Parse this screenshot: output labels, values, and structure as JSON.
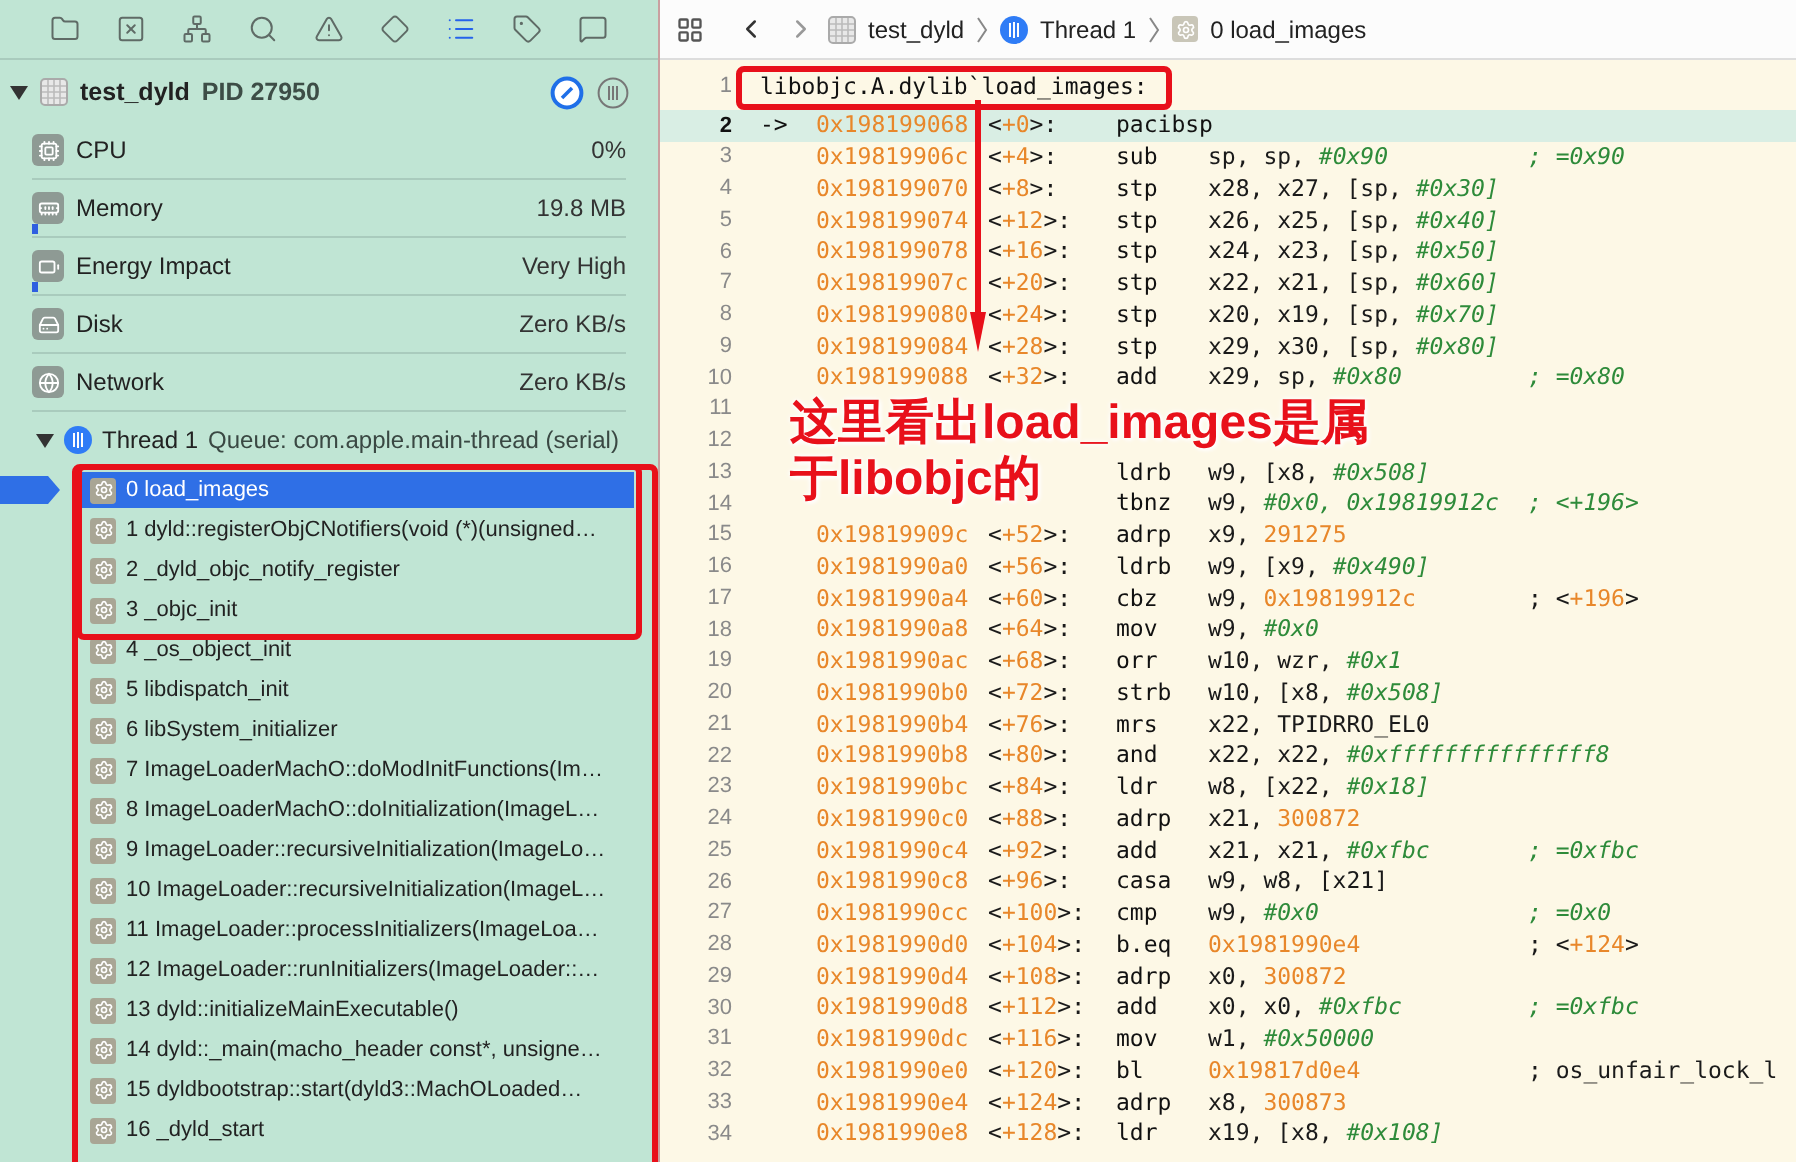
{
  "sidebar": {
    "toolbar": [
      {
        "kind": "folder",
        "selected": false
      },
      {
        "kind": "xbox",
        "selected": false
      },
      {
        "kind": "hierarchy",
        "selected": false
      },
      {
        "kind": "search",
        "selected": false
      },
      {
        "kind": "warning",
        "selected": false
      },
      {
        "kind": "diamond",
        "selected": false
      },
      {
        "kind": "list",
        "selected": true
      },
      {
        "kind": "tag",
        "selected": false
      },
      {
        "kind": "message",
        "selected": false
      }
    ],
    "process": {
      "name": "test_dyld",
      "pid": "PID 27950",
      "expanded": true
    },
    "gauges": [
      {
        "kind": "cpu",
        "label": "CPU",
        "value": "0%"
      },
      {
        "kind": "memory",
        "label": "Memory",
        "value": "19.8 MB",
        "level": 0.01
      },
      {
        "kind": "energy",
        "label": "Energy Impact",
        "value": "Very High",
        "level": 0.01
      },
      {
        "kind": "disk",
        "label": "Disk",
        "value": "Zero KB/s"
      },
      {
        "kind": "network",
        "label": "Network",
        "value": "Zero KB/s"
      }
    ],
    "thread": {
      "label": "Thread 1",
      "queue": "Queue: com.apple.main-thread (serial)",
      "expanded": true
    },
    "frames": [
      {
        "label": "0 load_images",
        "selected": true
      },
      {
        "label": "1 dyld::registerObjCNotifiers(void (*)(unsigned…",
        "selected": false
      },
      {
        "label": "2 _dyld_objc_notify_register",
        "selected": false
      },
      {
        "label": "3 _objc_init",
        "selected": false
      },
      {
        "label": "4 _os_object_init",
        "selected": false
      },
      {
        "label": "5 libdispatch_init",
        "selected": false
      },
      {
        "label": "6 libSystem_initializer",
        "selected": false
      },
      {
        "label": "7 ImageLoaderMachO::doModInitFunctions(Im…",
        "selected": false
      },
      {
        "label": "8 ImageLoaderMachO::doInitialization(ImageL…",
        "selected": false
      },
      {
        "label": "9 ImageLoader::recursiveInitialization(ImageLo…",
        "selected": false
      },
      {
        "label": "10 ImageLoader::recursiveInitialization(ImageL…",
        "selected": false
      },
      {
        "label": "11 ImageLoader::processInitializers(ImageLoa…",
        "selected": false
      },
      {
        "label": "12 ImageLoader::runInitializers(ImageLoader::…",
        "selected": false
      },
      {
        "label": "13 dyld::initializeMainExecutable()",
        "selected": false
      },
      {
        "label": "14 dyld::_main(macho_header const*, unsigne…",
        "selected": false
      },
      {
        "label": "15 dyldbootstrap::start(dyld3::MachOLoaded…",
        "selected": false
      },
      {
        "label": "16 _dyld_start",
        "selected": false
      }
    ]
  },
  "jump_bar": [
    {
      "kind": "process",
      "label": "test_dyld"
    },
    {
      "kind": "thread",
      "label": "Thread 1"
    },
    {
      "kind": "frame",
      "label": "0 load_images"
    }
  ],
  "code": {
    "header": {
      "n": "1",
      "text": "libobjc.A.dylib`load_images:"
    },
    "rows": [
      {
        "n": "2",
        "marker": "->",
        "addr": "0x198199068",
        "off": [
          {
            "text": "<",
            "kind": "plain"
          },
          {
            "text": "+0",
            "kind": "number"
          },
          {
            "text": ">:",
            "kind": "plain"
          }
        ],
        "op": "pacibsp"
      },
      {
        "n": "3",
        "addr": "0x19819906c",
        "off": [
          {
            "text": "<",
            "kind": "plain"
          },
          {
            "text": "+4",
            "kind": "number"
          },
          {
            "text": ">:",
            "kind": "plain"
          }
        ],
        "op": "sub",
        "args": [
          {
            "text": "sp, sp, ",
            "kind": "plain"
          },
          {
            "text": "#0x90",
            "kind": "immediate"
          }
        ],
        "cmt": [
          {
            "text": "; =0x90",
            "kind": "immediate"
          }
        ]
      },
      {
        "n": "4",
        "addr": "0x198199070",
        "off": [
          {
            "text": "<",
            "kind": "plain"
          },
          {
            "text": "+8",
            "kind": "number"
          },
          {
            "text": ">:",
            "kind": "plain"
          }
        ],
        "op": "stp",
        "args": [
          {
            "text": "x28, x27, [sp, ",
            "kind": "plain"
          },
          {
            "text": "#0x30]",
            "kind": "immediate"
          }
        ]
      },
      {
        "n": "5",
        "addr": "0x198199074",
        "off": [
          {
            "text": "<",
            "kind": "plain"
          },
          {
            "text": "+12",
            "kind": "number"
          },
          {
            "text": ">:",
            "kind": "plain"
          }
        ],
        "op": "stp",
        "args": [
          {
            "text": "x26, x25, [sp, ",
            "kind": "plain"
          },
          {
            "text": "#0x40]",
            "kind": "immediate"
          }
        ]
      },
      {
        "n": "6",
        "addr": "0x198199078",
        "off": [
          {
            "text": "<",
            "kind": "plain"
          },
          {
            "text": "+16",
            "kind": "number"
          },
          {
            "text": ">:",
            "kind": "plain"
          }
        ],
        "op": "stp",
        "args": [
          {
            "text": "x24, x23, [sp, ",
            "kind": "plain"
          },
          {
            "text": "#0x50]",
            "kind": "immediate"
          }
        ]
      },
      {
        "n": "7",
        "addr": "0x19819907c",
        "off": [
          {
            "text": "<",
            "kind": "plain"
          },
          {
            "text": "+20",
            "kind": "number"
          },
          {
            "text": ">:",
            "kind": "plain"
          }
        ],
        "op": "stp",
        "args": [
          {
            "text": "x22, x21, [sp, ",
            "kind": "plain"
          },
          {
            "text": "#0x60]",
            "kind": "immediate"
          }
        ]
      },
      {
        "n": "8",
        "addr": "0x198199080",
        "off": [
          {
            "text": "<",
            "kind": "plain"
          },
          {
            "text": "+24",
            "kind": "number"
          },
          {
            "text": ">:",
            "kind": "plain"
          }
        ],
        "op": "stp",
        "args": [
          {
            "text": "x20, x19, [sp, ",
            "kind": "plain"
          },
          {
            "text": "#0x70]",
            "kind": "immediate"
          }
        ]
      },
      {
        "n": "9",
        "addr": "0x198199084",
        "off": [
          {
            "text": "<",
            "kind": "plain"
          },
          {
            "text": "+28",
            "kind": "number"
          },
          {
            "text": ">:",
            "kind": "plain"
          }
        ],
        "op": "stp",
        "args": [
          {
            "text": "x29, x30, [sp, ",
            "kind": "plain"
          },
          {
            "text": "#0x80]",
            "kind": "immediate"
          }
        ]
      },
      {
        "n": "10",
        "addr": "0x198199088",
        "off": [
          {
            "text": "<",
            "kind": "plain"
          },
          {
            "text": "+32",
            "kind": "number"
          },
          {
            "text": ">:",
            "kind": "plain"
          }
        ],
        "op": "add",
        "args": [
          {
            "text": "x29, sp, ",
            "kind": "plain"
          },
          {
            "text": "#0x80",
            "kind": "immediate"
          }
        ],
        "cmt": [
          {
            "text": "; =0x80",
            "kind": "immediate"
          }
        ]
      },
      {
        "n": "11"
      },
      {
        "n": "12"
      },
      {
        "n": "13",
        "op": "ldrb",
        "args": [
          {
            "text": "w9, [x8, ",
            "kind": "plain"
          },
          {
            "text": "#0x508]",
            "kind": "immediate"
          }
        ]
      },
      {
        "n": "14",
        "op": "tbnz",
        "args": [
          {
            "text": "w9, ",
            "kind": "plain"
          },
          {
            "text": "#0x0, 0x19819912c",
            "kind": "immediate"
          }
        ],
        "cmt": [
          {
            "text": "; <+196>",
            "kind": "immediate"
          }
        ]
      },
      {
        "n": "15",
        "addr": "0x19819909c",
        "off": [
          {
            "text": "<",
            "kind": "plain"
          },
          {
            "text": "+52",
            "kind": "number"
          },
          {
            "text": ">:",
            "kind": "plain"
          }
        ],
        "op": "adrp",
        "args": [
          {
            "text": "x9, ",
            "kind": "plain"
          },
          {
            "text": "291275",
            "kind": "number"
          }
        ]
      },
      {
        "n": "16",
        "addr": "0x1981990a0",
        "off": [
          {
            "text": "<",
            "kind": "plain"
          },
          {
            "text": "+56",
            "kind": "number"
          },
          {
            "text": ">:",
            "kind": "plain"
          }
        ],
        "op": "ldrb",
        "args": [
          {
            "text": "w9, [x9, ",
            "kind": "plain"
          },
          {
            "text": "#0x490]",
            "kind": "immediate"
          }
        ]
      },
      {
        "n": "17",
        "addr": "0x1981990a4",
        "off": [
          {
            "text": "<",
            "kind": "plain"
          },
          {
            "text": "+60",
            "kind": "number"
          },
          {
            "text": ">:",
            "kind": "plain"
          }
        ],
        "op": "cbz",
        "args": [
          {
            "text": "w9, ",
            "kind": "plain"
          },
          {
            "text": "0x19819912c",
            "kind": "number"
          }
        ],
        "cmt": [
          {
            "text": "; <",
            "kind": "plain"
          },
          {
            "text": "+196",
            "kind": "number"
          },
          {
            "text": ">",
            "kind": "plain"
          }
        ]
      },
      {
        "n": "18",
        "addr": "0x1981990a8",
        "off": [
          {
            "text": "<",
            "kind": "plain"
          },
          {
            "text": "+64",
            "kind": "number"
          },
          {
            "text": ">:",
            "kind": "plain"
          }
        ],
        "op": "mov",
        "args": [
          {
            "text": "w9, ",
            "kind": "plain"
          },
          {
            "text": "#0x0",
            "kind": "immediate"
          }
        ]
      },
      {
        "n": "19",
        "addr": "0x1981990ac",
        "off": [
          {
            "text": "<",
            "kind": "plain"
          },
          {
            "text": "+68",
            "kind": "number"
          },
          {
            "text": ">:",
            "kind": "plain"
          }
        ],
        "op": "orr",
        "args": [
          {
            "text": "w10, wzr, ",
            "kind": "plain"
          },
          {
            "text": "#0x1",
            "kind": "immediate"
          }
        ]
      },
      {
        "n": "20",
        "addr": "0x1981990b0",
        "off": [
          {
            "text": "<",
            "kind": "plain"
          },
          {
            "text": "+72",
            "kind": "number"
          },
          {
            "text": ">:",
            "kind": "plain"
          }
        ],
        "op": "strb",
        "args": [
          {
            "text": "w10, [x8, ",
            "kind": "plain"
          },
          {
            "text": "#0x508]",
            "kind": "immediate"
          }
        ]
      },
      {
        "n": "21",
        "addr": "0x1981990b4",
        "off": [
          {
            "text": "<",
            "kind": "plain"
          },
          {
            "text": "+76",
            "kind": "number"
          },
          {
            "text": ">:",
            "kind": "plain"
          }
        ],
        "op": "mrs",
        "args": [
          {
            "text": "x22, TPIDRRO_EL0",
            "kind": "plain"
          }
        ]
      },
      {
        "n": "22",
        "addr": "0x1981990b8",
        "off": [
          {
            "text": "<",
            "kind": "plain"
          },
          {
            "text": "+80",
            "kind": "number"
          },
          {
            "text": ">:",
            "kind": "plain"
          }
        ],
        "op": "and",
        "args": [
          {
            "text": "x22, x22, ",
            "kind": "plain"
          },
          {
            "text": "#0xfffffffffffffff8",
            "kind": "immediate"
          }
        ]
      },
      {
        "n": "23",
        "addr": "0x1981990bc",
        "off": [
          {
            "text": "<",
            "kind": "plain"
          },
          {
            "text": "+84",
            "kind": "number"
          },
          {
            "text": ">:",
            "kind": "plain"
          }
        ],
        "op": "ldr",
        "args": [
          {
            "text": "w8, [x22, ",
            "kind": "plain"
          },
          {
            "text": "#0x18]",
            "kind": "immediate"
          }
        ]
      },
      {
        "n": "24",
        "addr": "0x1981990c0",
        "off": [
          {
            "text": "<",
            "kind": "plain"
          },
          {
            "text": "+88",
            "kind": "number"
          },
          {
            "text": ">:",
            "kind": "plain"
          }
        ],
        "op": "adrp",
        "args": [
          {
            "text": "x21, ",
            "kind": "plain"
          },
          {
            "text": "300872",
            "kind": "number"
          }
        ]
      },
      {
        "n": "25",
        "addr": "0x1981990c4",
        "off": [
          {
            "text": "<",
            "kind": "plain"
          },
          {
            "text": "+92",
            "kind": "number"
          },
          {
            "text": ">:",
            "kind": "plain"
          }
        ],
        "op": "add",
        "args": [
          {
            "text": "x21, x21, ",
            "kind": "plain"
          },
          {
            "text": "#0xfbc",
            "kind": "immediate"
          }
        ],
        "cmt": [
          {
            "text": "; =0xfbc",
            "kind": "immediate"
          }
        ]
      },
      {
        "n": "26",
        "addr": "0x1981990c8",
        "off": [
          {
            "text": "<",
            "kind": "plain"
          },
          {
            "text": "+96",
            "kind": "number"
          },
          {
            "text": ">:",
            "kind": "plain"
          }
        ],
        "op": "casa",
        "args": [
          {
            "text": "w9, w8, [x21]",
            "kind": "plain"
          }
        ]
      },
      {
        "n": "27",
        "addr": "0x1981990cc",
        "off": [
          {
            "text": "<",
            "kind": "plain"
          },
          {
            "text": "+100",
            "kind": "number"
          },
          {
            "text": ">:",
            "kind": "plain"
          }
        ],
        "op": "cmp",
        "args": [
          {
            "text": "w9, ",
            "kind": "plain"
          },
          {
            "text": "#0x0",
            "kind": "immediate"
          }
        ],
        "cmt": [
          {
            "text": "; =0x0",
            "kind": "immediate"
          }
        ]
      },
      {
        "n": "28",
        "addr": "0x1981990d0",
        "off": [
          {
            "text": "<",
            "kind": "plain"
          },
          {
            "text": "+104",
            "kind": "number"
          },
          {
            "text": ">:",
            "kind": "plain"
          }
        ],
        "op": "b.eq",
        "args": [
          {
            "text": "0x1981990e4",
            "kind": "number"
          }
        ],
        "cmt": [
          {
            "text": "; <",
            "kind": "plain"
          },
          {
            "text": "+124",
            "kind": "number"
          },
          {
            "text": ">",
            "kind": "plain"
          }
        ]
      },
      {
        "n": "29",
        "addr": "0x1981990d4",
        "off": [
          {
            "text": "<",
            "kind": "plain"
          },
          {
            "text": "+108",
            "kind": "number"
          },
          {
            "text": ">:",
            "kind": "plain"
          }
        ],
        "op": "adrp",
        "args": [
          {
            "text": "x0, ",
            "kind": "plain"
          },
          {
            "text": "300872",
            "kind": "number"
          }
        ]
      },
      {
        "n": "30",
        "addr": "0x1981990d8",
        "off": [
          {
            "text": "<",
            "kind": "plain"
          },
          {
            "text": "+112",
            "kind": "number"
          },
          {
            "text": ">:",
            "kind": "plain"
          }
        ],
        "op": "add",
        "args": [
          {
            "text": "x0, x0, ",
            "kind": "plain"
          },
          {
            "text": "#0xfbc",
            "kind": "immediate"
          }
        ],
        "cmt": [
          {
            "text": "; =0xfbc",
            "kind": "immediate"
          }
        ]
      },
      {
        "n": "31",
        "addr": "0x1981990dc",
        "off": [
          {
            "text": "<",
            "kind": "plain"
          },
          {
            "text": "+116",
            "kind": "number"
          },
          {
            "text": ">:",
            "kind": "plain"
          }
        ],
        "op": "mov",
        "args": [
          {
            "text": "w1, ",
            "kind": "plain"
          },
          {
            "text": "#0x50000",
            "kind": "immediate"
          }
        ]
      },
      {
        "n": "32",
        "addr": "0x1981990e0",
        "off": [
          {
            "text": "<",
            "kind": "plain"
          },
          {
            "text": "+120",
            "kind": "number"
          },
          {
            "text": ">:",
            "kind": "plain"
          }
        ],
        "op": "bl",
        "args": [
          {
            "text": "0x19817d0e4",
            "kind": "number"
          }
        ],
        "cmt": [
          {
            "text": "; os_unfair_lock_l",
            "kind": "plain"
          }
        ]
      },
      {
        "n": "33",
        "addr": "0x1981990e4",
        "off": [
          {
            "text": "<",
            "kind": "plain"
          },
          {
            "text": "+124",
            "kind": "number"
          },
          {
            "text": ">:",
            "kind": "plain"
          }
        ],
        "op": "adrp",
        "args": [
          {
            "text": "x8, ",
            "kind": "plain"
          },
          {
            "text": "300873",
            "kind": "number"
          }
        ]
      },
      {
        "n": "34",
        "addr": "0x1981990e8",
        "off": [
          {
            "text": "<",
            "kind": "plain"
          },
          {
            "text": "+128",
            "kind": "number"
          },
          {
            "text": ">:",
            "kind": "plain"
          }
        ],
        "op": "ldr",
        "args": [
          {
            "text": "x19, [x8, ",
            "kind": "plain"
          },
          {
            "text": "#0x108]",
            "kind": "immediate"
          }
        ]
      }
    ]
  },
  "annotation": {
    "lines": [
      "这里看出load_images是属",
      "于libobjc的"
    ]
  }
}
